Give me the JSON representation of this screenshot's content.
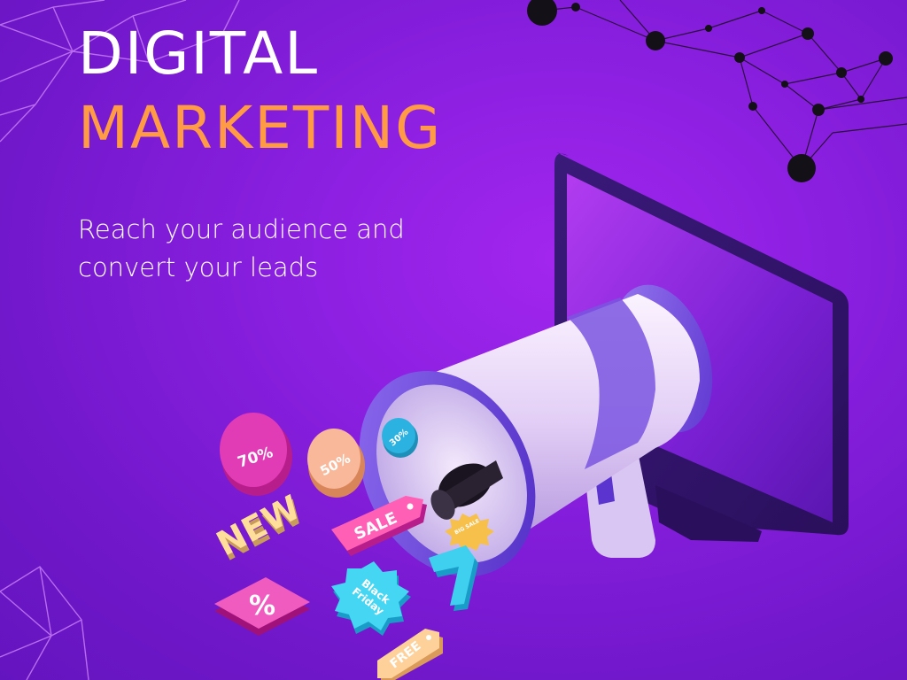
{
  "headline": {
    "line1": "DIGITAL",
    "line2": "MARKETING"
  },
  "tagline": {
    "line1": "Reach your audience and",
    "line2": "convert your leads"
  },
  "badges": {
    "seventy": "70%",
    "fifty": "50%",
    "thirty": "30%",
    "new": "NEW",
    "sale": "SALE",
    "big_sale": "BIG SALE",
    "percent": "%",
    "black_friday_1": "Black",
    "black_friday_2": "Friday",
    "free": "FREE"
  },
  "colors": {
    "background": "#8a1fe0",
    "headline_white": "#ffffff",
    "headline_orange": "#ff9a45"
  },
  "icons": [
    "megaphone-icon",
    "monitor-icon",
    "network-graph-decoration",
    "polygon-mesh-decoration"
  ]
}
